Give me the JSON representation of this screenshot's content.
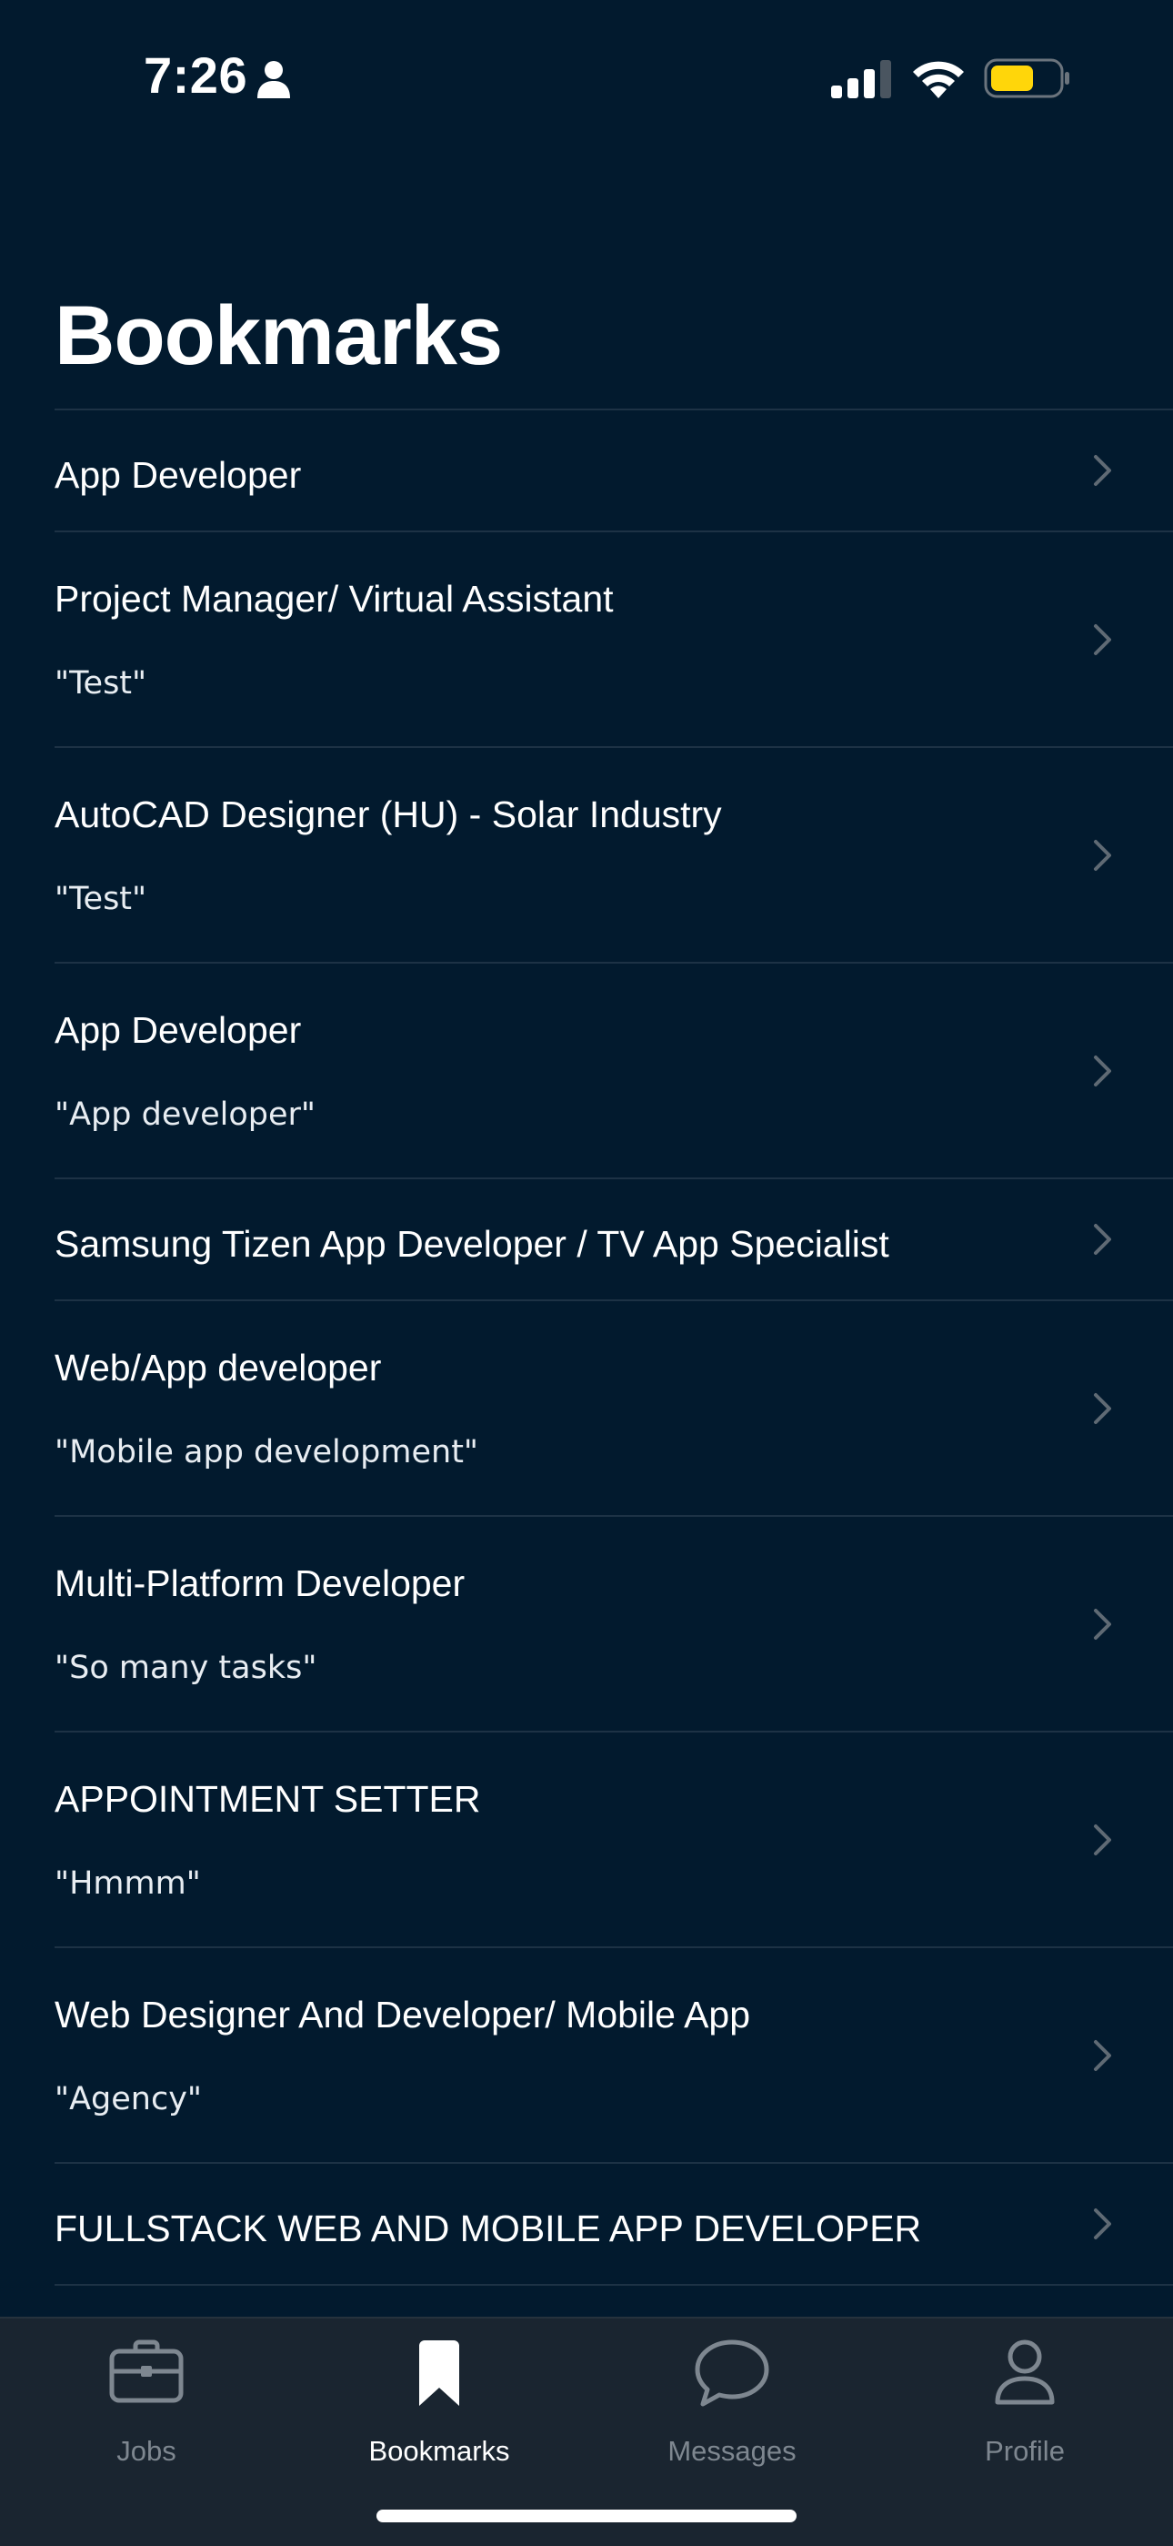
{
  "status_bar": {
    "time": "7:26",
    "icons": [
      "person-icon",
      "signal-icon",
      "wifi-icon",
      "battery-icon"
    ],
    "battery_color": "#ffd60a"
  },
  "page": {
    "title": "Bookmarks",
    "background": "#021a2e",
    "divider_color": "#1d3245"
  },
  "bookmarks": [
    {
      "title": "App Developer",
      "note": ""
    },
    {
      "title": "Project Manager/ Virtual Assistant",
      "note": "\"Test\""
    },
    {
      "title": "AutoCAD Designer (HU) - Solar Industry",
      "note": "\"Test\""
    },
    {
      "title": "App Developer",
      "note": "\"App developer\""
    },
    {
      "title": "Samsung Tizen App Developer / TV App Specialist",
      "note": ""
    },
    {
      "title": "Web/App developer",
      "note": "\"Mobile app development\""
    },
    {
      "title": "Multi-Platform Developer",
      "note": "\"So many tasks\""
    },
    {
      "title": "APPOINTMENT SETTER",
      "note": "\"Hmmm\""
    },
    {
      "title": "Web Designer And Developer/ Mobile App",
      "note": "\"Agency\""
    },
    {
      "title": "FULLSTACK WEB AND MOBILE APP DEVELOPER",
      "note": ""
    }
  ],
  "tab_bar": {
    "tabs": [
      {
        "label": "Jobs",
        "icon": "briefcase-icon",
        "active": false
      },
      {
        "label": "Bookmarks",
        "icon": "bookmark-icon",
        "active": true
      },
      {
        "label": "Messages",
        "icon": "chat-bubble-icon",
        "active": false
      },
      {
        "label": "Profile",
        "icon": "person-icon",
        "active": false
      }
    ],
    "active_color": "#ffffff",
    "inactive_color": "#7e8790"
  }
}
